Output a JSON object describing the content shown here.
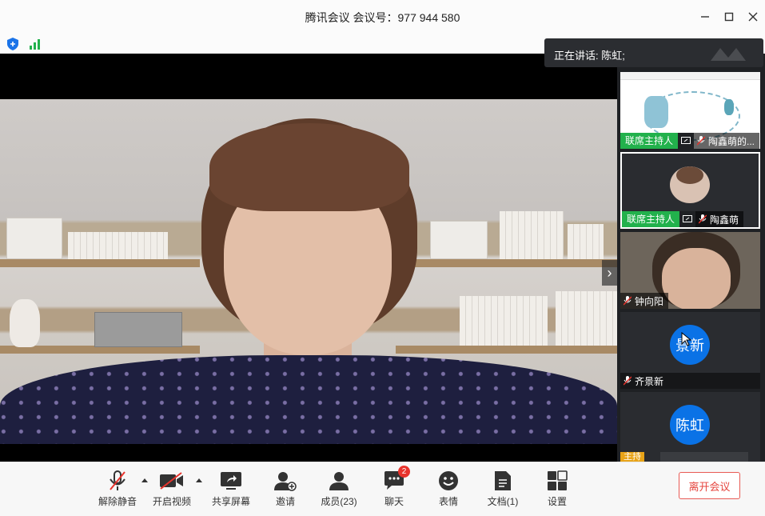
{
  "window": {
    "title": "腾讯会议 会议号：977 944 580"
  },
  "speaking": {
    "text": "正在讲话: 陈虹;"
  },
  "participants": [
    {
      "host_label": "联席主持人",
      "name": "陶鑫萌的...",
      "content": "document-share"
    },
    {
      "host_label": "联席主持人",
      "name": "陶鑫萌",
      "content": "camera"
    },
    {
      "host_label": "",
      "name": "钟向阳",
      "content": "camera"
    },
    {
      "host_label": "",
      "name": "齐景新",
      "avatar_text": "景新",
      "content": "avatar"
    },
    {
      "host_label": "",
      "name": "",
      "avatar_text": "陈虹",
      "content": "avatar",
      "partial_label": "主持"
    }
  ],
  "toolbar": {
    "mute": "解除静音",
    "video": "开启视频",
    "share": "共享屏幕",
    "invite": "邀请",
    "members": "成员(23)",
    "chat": "聊天",
    "chat_badge": "2",
    "emoji": "表情",
    "docs": "文档(1)",
    "settings": "设置",
    "leave": "离开会议"
  },
  "colors": {
    "host_tag": "#22b14c",
    "avatar_blue": "#0a72e6",
    "leave_red": "#e6463f",
    "badge_red": "#e8332c"
  }
}
